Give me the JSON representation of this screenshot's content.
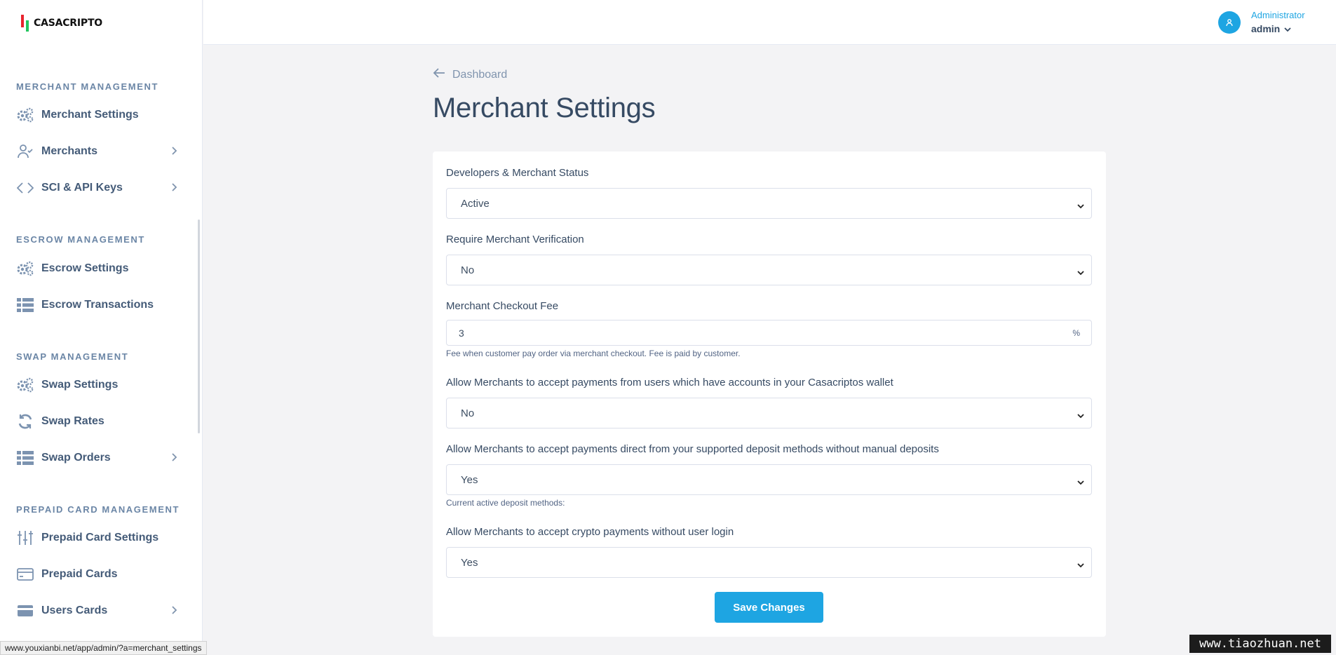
{
  "brand": {
    "name": "CASACRIPTO"
  },
  "sidebar": {
    "sections": [
      {
        "heading": "MERCHANT MANAGEMENT"
      },
      {
        "heading": "ESCROW MANAGEMENT"
      },
      {
        "heading": "SWAP MANAGEMENT"
      },
      {
        "heading": "PREPAID CARD MANAGEMENT"
      }
    ],
    "items": [
      {
        "label": "Merchant Settings",
        "icon": "gears-icon"
      },
      {
        "label": "Merchants",
        "icon": "user-check-icon",
        "has_submenu": true
      },
      {
        "label": "SCI & API Keys",
        "icon": "code-icon",
        "has_submenu": true
      },
      {
        "label": "Escrow Settings",
        "icon": "gears-icon"
      },
      {
        "label": "Escrow Transactions",
        "icon": "list-icon"
      },
      {
        "label": "Swap Settings",
        "icon": "gears-icon"
      },
      {
        "label": "Swap Rates",
        "icon": "refresh-icon"
      },
      {
        "label": "Swap Orders",
        "icon": "list-icon",
        "has_submenu": true
      },
      {
        "label": "Prepaid Card Settings",
        "icon": "sliders-icon"
      },
      {
        "label": "Prepaid Cards",
        "icon": "card-icon"
      },
      {
        "label": "Users Cards",
        "icon": "cards-icon",
        "has_submenu": true
      }
    ]
  },
  "header": {
    "user_role": "Administrator",
    "user_name": "admin"
  },
  "main": {
    "breadcrumb": "Dashboard",
    "title": "Merchant Settings",
    "fields": [
      {
        "label": "Developers & Merchant Status",
        "value": "Active"
      },
      {
        "label": "Require Merchant Verification",
        "value": "No"
      },
      {
        "label": "Merchant Checkout Fee",
        "value": "3",
        "suffix": "%",
        "hint": "Fee when customer pay order via merchant checkout. Fee is paid by customer."
      },
      {
        "label": "Allow Merchants to accept payments from users which have accounts in your Casacriptos wallet",
        "value": "No"
      },
      {
        "label": "Allow Merchants to accept payments direct from your supported deposit methods without manual deposits",
        "value": "Yes",
        "hint": "Current active deposit methods:"
      },
      {
        "label": "Allow Merchants to accept crypto payments without user login",
        "value": "Yes"
      }
    ],
    "save_label": "Save Changes"
  },
  "status_bar_url": "www.youxianbi.net/app/admin/?a=merchant_settings",
  "watermark": "www.tiaozhuan.net",
  "colors": {
    "accent": "#1ea5e2",
    "text": "#364a63",
    "muted": "#8094ae",
    "background": "#f3f3f5"
  }
}
